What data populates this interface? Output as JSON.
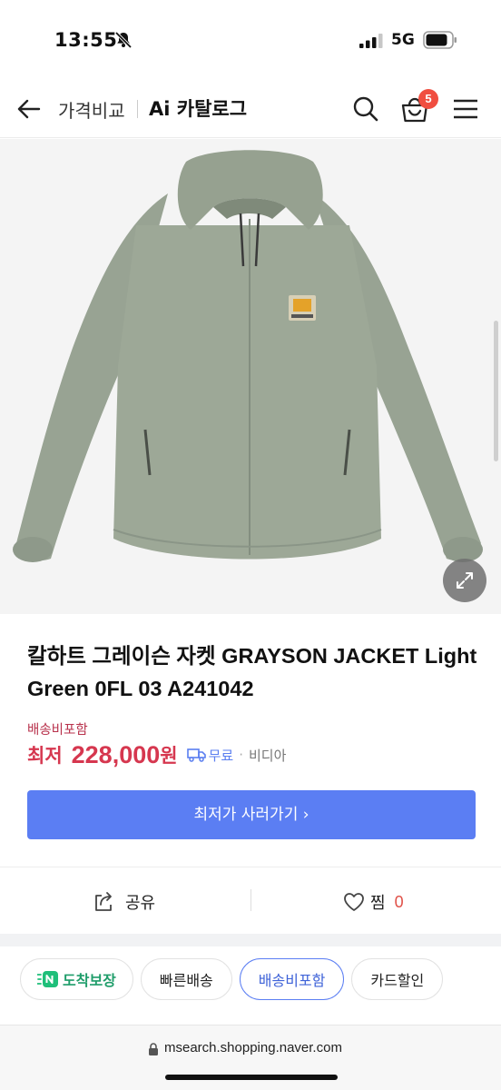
{
  "status_bar": {
    "time": "13:55",
    "network": "5G"
  },
  "header": {
    "compare_label": "가격비교",
    "catalog_label": "Ai 카탈로그",
    "cart_count": "5"
  },
  "product": {
    "title": "칼하트 그레이슨 자켓 GRAYSON JACKET Light Green 0FL 03 A241042",
    "shipping_note": "배송비포함",
    "price_prefix": "최저",
    "price": "228,000",
    "price_unit": "원",
    "free_shipping": "무료",
    "separator": "·",
    "seller": "비디아"
  },
  "cta": {
    "label": "최저가 사러가기 ›"
  },
  "actions": {
    "share_label": "공유",
    "like_label": "찜",
    "like_count": "0"
  },
  "chips": [
    {
      "label": "도착보장"
    },
    {
      "label": "빠른배송"
    },
    {
      "label": "배송비포함"
    },
    {
      "label": "카드할인"
    }
  ],
  "address_bar": {
    "url": "msearch.shopping.naver.com"
  },
  "colors": {
    "accent": "#5b7ef3",
    "price": "#d6374f",
    "badge": "#f04e40",
    "jacket": "#9aa596"
  }
}
